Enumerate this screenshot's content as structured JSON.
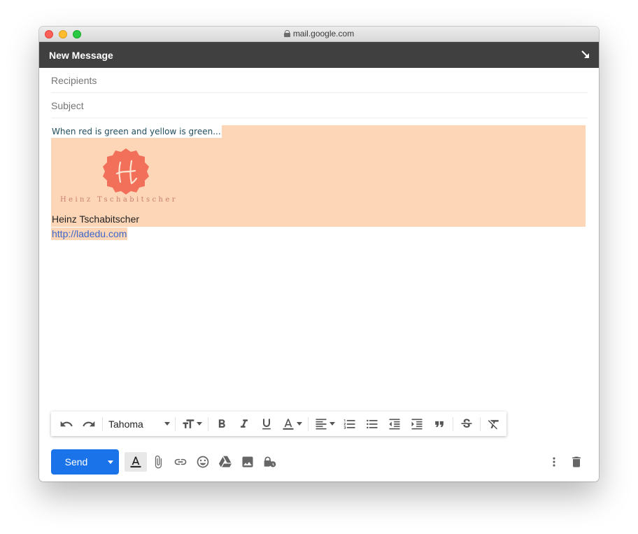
{
  "browser": {
    "url": "mail.google.com"
  },
  "compose": {
    "title": "New Message",
    "recipients_placeholder": "Recipients",
    "subject_placeholder": "Subject",
    "body": {
      "intro": "When red is green and yellow is green...",
      "logo_text": "Heinz Tschabitscher",
      "signature_name": "Heinz Tschabitscher",
      "signature_link": "http://ladedu.com"
    }
  },
  "toolbar": {
    "font": "Tahoma",
    "buttons": [
      "undo-icon",
      "redo-icon",
      "text-size-icon",
      "bold-icon",
      "italic-icon",
      "underline-icon",
      "text-color-icon",
      "align-icon",
      "numbered-list-icon",
      "bulleted-list-icon",
      "indent-less-icon",
      "indent-more-icon",
      "quote-icon",
      "strikethrough-icon",
      "remove-formatting-icon"
    ]
  },
  "actions": {
    "send_label": "Send",
    "icons": [
      "formatting-options-icon",
      "attach-icon",
      "insert-link-icon",
      "emoji-icon",
      "drive-icon",
      "insert-photo-icon",
      "confidential-mode-icon",
      "more-options-icon",
      "discard-icon"
    ]
  },
  "colors": {
    "header_bg": "#404040",
    "signature_bg": "#fdd5b7",
    "send_button": "#1a73e8",
    "logo": "#f2705a",
    "link": "#3b67c9"
  }
}
